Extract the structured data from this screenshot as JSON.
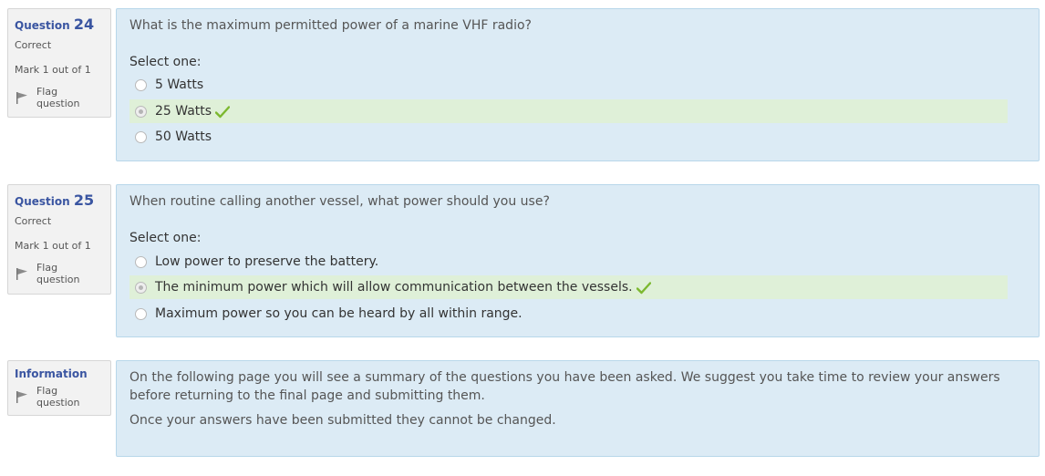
{
  "questions": [
    {
      "label": "Question",
      "number": "24",
      "state": "Correct",
      "grade": "Mark 1 out of 1",
      "flag_label": "Flag question",
      "text": "What is the maximum permitted power of a marine VHF radio?",
      "prompt": "Select one:",
      "options": [
        {
          "label": "5 Watts",
          "selected": false,
          "correct": false
        },
        {
          "label": "25 Watts",
          "selected": true,
          "correct": true
        },
        {
          "label": "50 Watts",
          "selected": false,
          "correct": false
        }
      ]
    },
    {
      "label": "Question",
      "number": "25",
      "state": "Correct",
      "grade": "Mark 1 out of 1",
      "flag_label": "Flag question",
      "text": "When routine calling another vessel, what power should you use?",
      "prompt": "Select one:",
      "options": [
        {
          "label": "Low power to preserve the battery.",
          "selected": false,
          "correct": false
        },
        {
          "label": "The minimum power which will allow communication between the vessels.",
          "selected": true,
          "correct": true
        },
        {
          "label": "Maximum power so you can be heard by all within range.",
          "selected": false,
          "correct": false
        }
      ]
    }
  ],
  "information": {
    "label": "Information",
    "flag_label": "Flag question",
    "paragraph1": "On the following page you will see a summary of the questions you have been asked. We suggest you take time to review your answers before returning to the final page and submitting them.",
    "paragraph2": "Once your answers have been submitted they cannot be changed."
  },
  "colors": {
    "accent": "#3a55a1",
    "content_bg": "#dcebf5",
    "correct_bg": "#dff0d8",
    "tick": "#7cb82f"
  },
  "icons": {
    "flag": "flag-icon",
    "tick": "check-icon"
  }
}
